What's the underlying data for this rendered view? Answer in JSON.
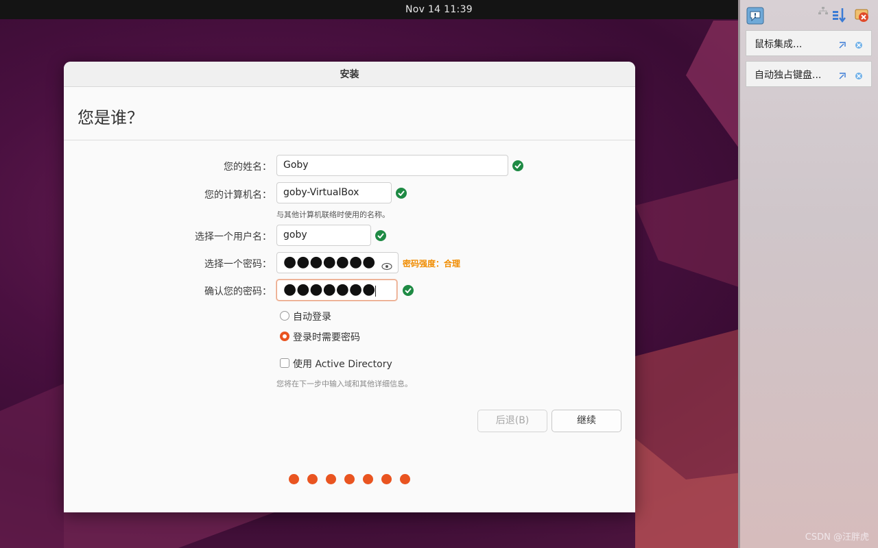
{
  "topbar": {
    "clock": "Nov 14  11:39"
  },
  "window": {
    "title": "安装",
    "heading": "您是谁？",
    "fields": {
      "name_label": "您的姓名：",
      "name_value": "Goby",
      "computer_label": "您的计算机名：",
      "computer_value": "goby-VirtualBox",
      "computer_hint": "与其他计算机联络时使用的名称。",
      "username_label": "选择一个用户名：",
      "username_value": "goby",
      "password_label": "选择一个密码：",
      "password_value": "●●●●●●●",
      "password_strength": "密码强度：合理",
      "confirm_label": "确认您的密码：",
      "confirm_value": "●●●●●●●"
    },
    "options": {
      "auto_login": "自动登录",
      "require_password": "登录时需要密码",
      "selected": "require_password",
      "active_directory": "使用 Active Directory",
      "active_directory_hint": "您将在下一步中输入域和其他详细信息。"
    },
    "buttons": {
      "back": "后退(B)",
      "continue": "继续"
    },
    "progress_steps": 7,
    "accent": "#e95420"
  },
  "side_panel": {
    "items": [
      {
        "label": "鼠标集成..."
      },
      {
        "label": "自动独占键盘..."
      }
    ]
  },
  "watermark": "CSDN @汪胖虎"
}
